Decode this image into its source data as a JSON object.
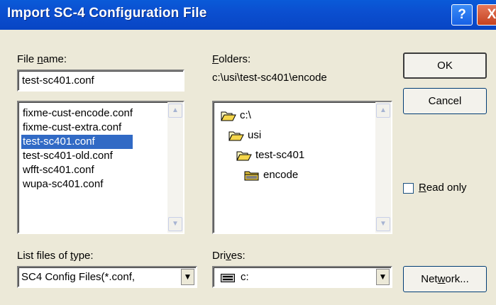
{
  "window": {
    "title": "Import SC-4 Configuration File",
    "help_glyph": "?",
    "close_glyph": "X"
  },
  "file_name": {
    "label_pre": "File ",
    "label_ul": "n",
    "label_post": "ame:",
    "value": "test-sc401.conf",
    "files": [
      "fixme-cust-encode.conf",
      "fixme-cust-extra.conf",
      "test-sc401.conf",
      "test-sc401-old.conf",
      "wfft-sc401.conf",
      "wupa-sc401.conf"
    ],
    "selected_index": 2
  },
  "folders": {
    "label_ul": "F",
    "label_post": "olders:",
    "current_path": "c:\\usi\\test-sc401\\encode",
    "tree": [
      "c:\\",
      "usi",
      "test-sc401",
      "encode"
    ]
  },
  "buttons": {
    "ok": "OK",
    "cancel": "Cancel",
    "network_pre": "Net",
    "network_ul": "w",
    "network_post": "ork..."
  },
  "read_only": {
    "label_ul": "R",
    "label_post": "ead only",
    "checked": false
  },
  "file_type": {
    "label_pre": "List files of ",
    "label_ul": "t",
    "label_post": "ype:",
    "value": "SC4 Config Files(*.conf,",
    "arrow": "▼"
  },
  "drives": {
    "label_pre": "Dri",
    "label_ul": "v",
    "label_post": "es:",
    "value": "c:",
    "arrow": "▼"
  },
  "scroll": {
    "up": "▲",
    "down": "▼"
  }
}
